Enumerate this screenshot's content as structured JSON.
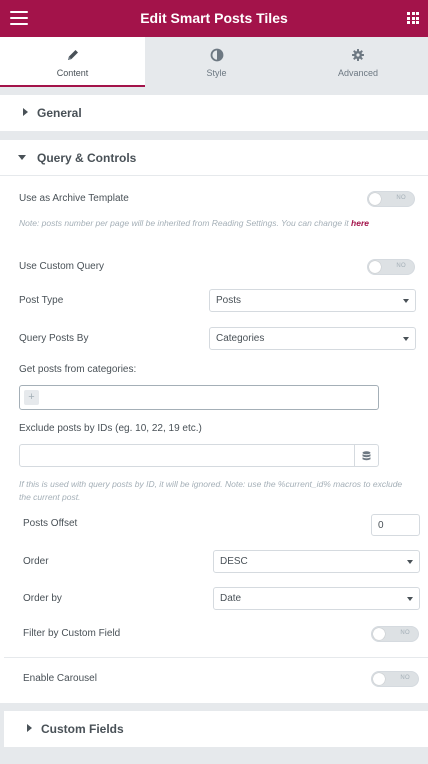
{
  "header": {
    "title": "Edit Smart Posts Tiles",
    "menu_icon": "hamburger-icon",
    "apps_icon": "grid-icon"
  },
  "tabs": [
    {
      "label": "Content",
      "icon": "pencil-icon",
      "active": true
    },
    {
      "label": "Style",
      "icon": "half-circle-icon",
      "active": false
    },
    {
      "label": "Advanced",
      "icon": "gear-icon",
      "active": false
    }
  ],
  "sections": {
    "general": "General",
    "query": "Query & Controls",
    "custom_fields": "Custom Fields"
  },
  "controls": {
    "archive_label": "Use as Archive Template",
    "archive_toggle": "NO",
    "archive_note": "Note: posts number per page will be inherited from Reading Settings. You can change it",
    "archive_note_link": "here",
    "custom_query_label": "Use Custom Query",
    "custom_query_toggle": "NO",
    "post_type_label": "Post Type",
    "post_type_value": "Posts",
    "query_by_label": "Query Posts By",
    "query_by_value": "Categories",
    "categories_label": "Get posts from categories:",
    "categories_add": "+",
    "exclude_label": "Exclude posts by IDs (eg. 10, 22, 19 etc.)",
    "exclude_note": "If this is used with query posts by ID, it will be ignored. Note: use the %current_id% macros to exclude the current post.",
    "offset_label": "Posts Offset",
    "offset_value": "0",
    "order_label": "Order",
    "order_value": "DESC",
    "order_by_label": "Order by",
    "order_by_value": "Date",
    "filter_label": "Filter by Custom Field",
    "filter_toggle": "NO",
    "carousel_label": "Enable Carousel",
    "carousel_toggle": "NO"
  },
  "colors": {
    "brand": "#a3134a",
    "text": "#495157",
    "muted": "#a4afb7",
    "panel_bg": "#e6e9ec"
  }
}
